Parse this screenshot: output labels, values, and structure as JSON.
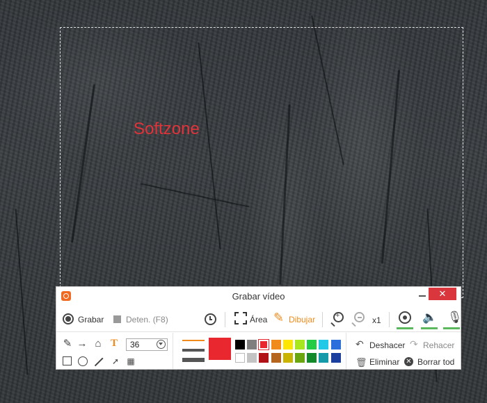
{
  "canvas": {
    "annotation_text": "Softzone"
  },
  "window": {
    "title": "Grabar vídeo",
    "close_label": "✕"
  },
  "toolbar": {
    "record_label": "Grabar",
    "stop_label": "Deten. (F8)",
    "area_label": "Área",
    "draw_label": "Dibujar",
    "zoom_level": "x1"
  },
  "draw": {
    "font_size": "36",
    "text_tool_glyph": "T",
    "current_color": "#e8282e",
    "palette_top": [
      "#000000",
      "#7f7f7f",
      "#e8282e",
      "#f08a1a",
      "#ffe600",
      "#a8e61d",
      "#22cc44",
      "#22c9e6",
      "#2a6fdb"
    ],
    "palette_bottom": [
      "#ffffff",
      "#c3c3c3",
      "#b01218",
      "#b5651d",
      "#c9b400",
      "#6aa610",
      "#128a2a",
      "#149aa8",
      "#1a3f9e"
    ],
    "selected_swatch": 2
  },
  "actions": {
    "undo_label": "Deshacer",
    "redo_label": "Rehacer",
    "delete_label": "Eliminar",
    "clear_label": "Borrar tod"
  }
}
